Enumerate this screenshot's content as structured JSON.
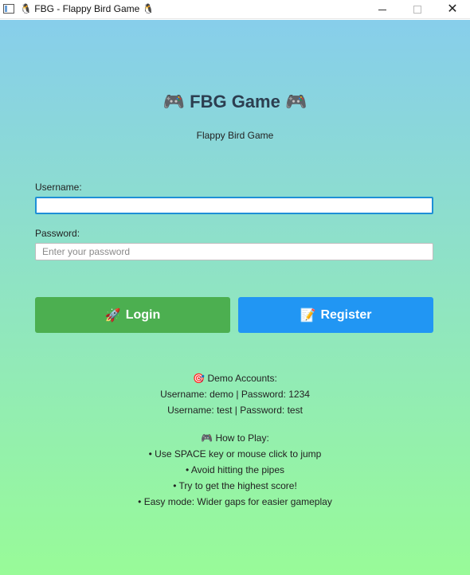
{
  "window": {
    "title": "🐧 FBG - Flappy Bird Game 🐧",
    "minimize": "",
    "maximize": "",
    "close": "✕"
  },
  "header": {
    "title": "🎮 FBG Game 🎮",
    "subtitle": "Flappy Bird Game"
  },
  "form": {
    "username_label": "Username:",
    "username_value": "",
    "username_placeholder": "",
    "password_label": "Password:",
    "password_value": "",
    "password_placeholder": "Enter your password"
  },
  "buttons": {
    "login_icon": "🚀",
    "login_label": "Login",
    "register_icon": "📝",
    "register_label": "Register"
  },
  "demo": {
    "heading": "🎯 Demo Accounts:",
    "lines": [
      "Username: demo | Password: 1234",
      "Username: test | Password: test"
    ]
  },
  "how_to_play": {
    "heading": "🎮 How to Play:",
    "items": [
      "• Use SPACE key or mouse click to jump",
      "• Avoid hitting the pipes",
      "• Try to get the highest score!",
      "• Easy mode: Wider gaps for easier gameplay"
    ]
  },
  "colors": {
    "gradient_top": "#87ceeb",
    "gradient_bottom": "#98fb98",
    "login_button": "#4caf50",
    "register_button": "#2196f3",
    "title_text": "#2c3e50",
    "focus_border": "#1e8fd6"
  }
}
